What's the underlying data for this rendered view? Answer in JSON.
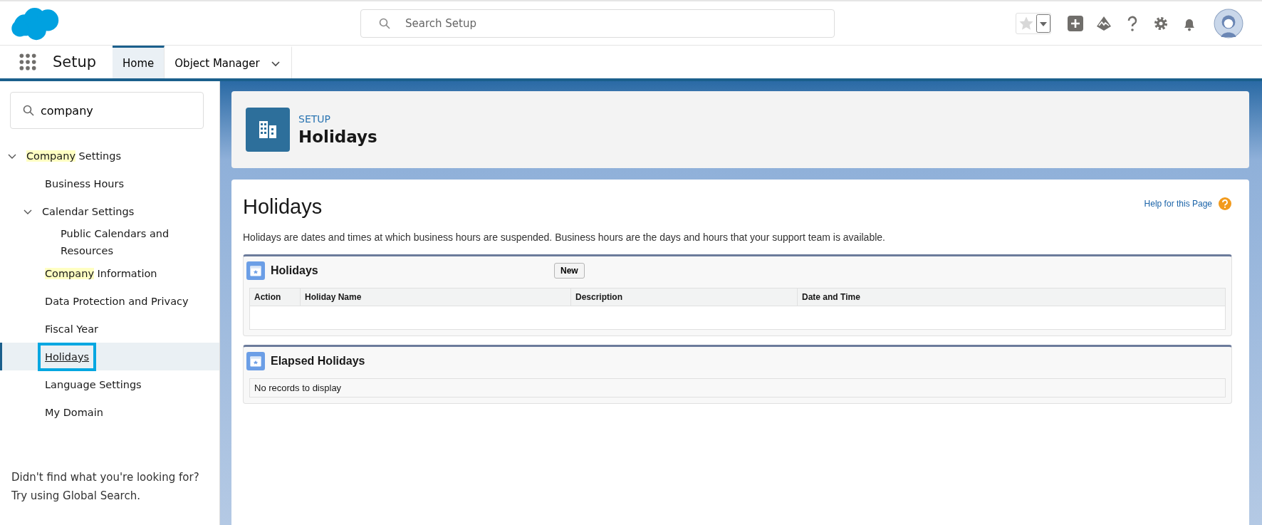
{
  "header": {
    "search": {
      "placeholder": "Search Setup"
    }
  },
  "nav": {
    "app_name": "Setup",
    "tabs": [
      {
        "label": "Home",
        "selected": true,
        "dropdown": false
      },
      {
        "label": "Object Manager",
        "selected": false,
        "dropdown": true
      }
    ]
  },
  "sidebar": {
    "search": {
      "value": "company"
    },
    "tree": [
      {
        "match": "Company",
        "rest": " Settings",
        "expanded": true,
        "selected": false,
        "children": [
          {
            "rest": "Business Hours",
            "selected": false
          },
          {
            "rest": "Calendar Settings",
            "expanded": true,
            "selected": false,
            "children": [
              {
                "rest": "Public Calendars and Resources",
                "selected": false
              }
            ]
          },
          {
            "match": "Company",
            "rest": " Information",
            "selected": false
          },
          {
            "rest": "Data Protection and Privacy",
            "selected": false
          },
          {
            "rest": "Fiscal Year",
            "selected": false
          },
          {
            "rest": "Holidays",
            "selected": true
          },
          {
            "rest": "Language Settings",
            "selected": false
          },
          {
            "rest": "My Domain",
            "selected": false
          }
        ]
      }
    ],
    "footer_lines": [
      "Didn't find what you're looking for?",
      "Try using Global Search."
    ]
  },
  "page_header": {
    "eyebrow": "SETUP",
    "title": "Holidays"
  },
  "content": {
    "title": "Holidays",
    "help_link": "Help for this Page",
    "description": "Holidays are dates and times at which business hours are suspended. Business hours are the days and hours that your support team is available.",
    "sections": [
      {
        "title": "Holidays",
        "button": "New",
        "columns": [
          "Action",
          "Holiday Name",
          "Description",
          "Date and Time"
        ]
      },
      {
        "title": "Elapsed Holidays",
        "empty_message": "No records to display"
      }
    ]
  }
}
